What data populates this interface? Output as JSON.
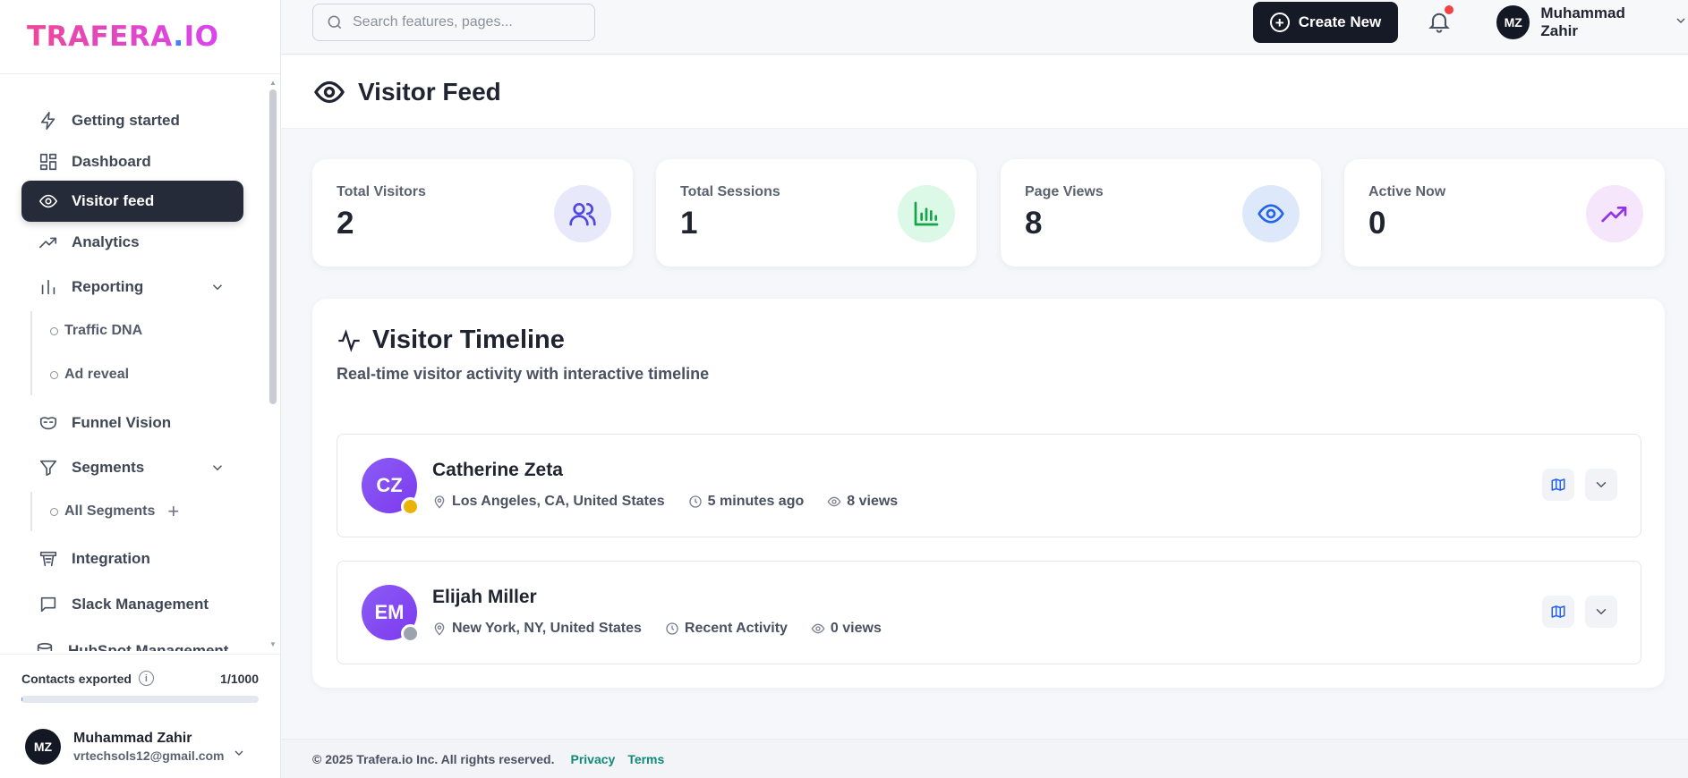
{
  "brand": {
    "logo_main": "TRAFERA",
    "logo_dot": ".",
    "logo_tail": "IO"
  },
  "sidebar": {
    "items": [
      {
        "label": "Getting started",
        "icon": "bolt-icon"
      },
      {
        "label": "Dashboard",
        "icon": "grid-icon"
      },
      {
        "label": "Visitor feed",
        "icon": "eye-icon",
        "active": true
      },
      {
        "label": "Analytics",
        "icon": "trending-up-icon"
      },
      {
        "label": "Reporting",
        "icon": "bar-chart-icon",
        "expandable": true
      },
      {
        "label": "Funnel Vision",
        "icon": "mask-icon"
      },
      {
        "label": "Segments",
        "icon": "filter-icon",
        "expandable": true
      },
      {
        "label": "Integration",
        "icon": "integration-icon"
      },
      {
        "label": "Slack Management",
        "icon": "message-icon"
      },
      {
        "label": "HubSpot Management",
        "icon": "database-icon"
      }
    ],
    "reporting_sub": [
      "Traffic DNA",
      "Ad reveal"
    ],
    "segments_sub": [
      "All Segments"
    ],
    "contacts": {
      "label": "Contacts exported",
      "count": "1/1000",
      "progress": 0.001
    },
    "user": {
      "initials": "MZ",
      "name": "Muhammad Zahir",
      "email": "vrtechsols12@gmail.com"
    }
  },
  "topbar": {
    "search_placeholder": "Search features, pages...",
    "create_label": "Create New",
    "user_initials": "MZ",
    "user_name": "Muhammad Zahir"
  },
  "page": {
    "title": "Visitor Feed"
  },
  "stats": [
    {
      "label": "Total Visitors",
      "value": "2",
      "icon": "users-icon",
      "bg": "#e7e9fb",
      "stroke": "#4f46e5"
    },
    {
      "label": "Total Sessions",
      "value": "1",
      "icon": "bar-chart-icon",
      "bg": "#dcf8e6",
      "stroke": "#16a34a"
    },
    {
      "label": "Page Views",
      "value": "8",
      "icon": "eye-icon",
      "bg": "#dde9fb",
      "stroke": "#2563eb"
    },
    {
      "label": "Active Now",
      "value": "0",
      "icon": "trending-up-icon",
      "bg": "#f5e6fb",
      "stroke": "#9333ea"
    }
  ],
  "timeline": {
    "title": "Visitor Timeline",
    "subtitle": "Real-time visitor activity with interactive timeline",
    "visitors": [
      {
        "initials": "CZ",
        "name": "Catherine Zeta",
        "location": "Los Angeles, CA, United States",
        "time": "5 minutes ago",
        "views": "8 views",
        "status_color": "#eab308"
      },
      {
        "initials": "EM",
        "name": "Elijah Miller",
        "location": "New York, NY, United States",
        "time": "Recent Activity",
        "views": "0 views",
        "status_color": "#9ca3af"
      }
    ]
  },
  "footer": {
    "copyright": "© 2025 Trafera.io Inc. All rights reserved.",
    "privacy": "Privacy",
    "terms": "Terms"
  },
  "colors": {
    "accent_dark": "#151a26",
    "brand_pink": "#e83e8c",
    "footer_link": "#0f8a74"
  }
}
